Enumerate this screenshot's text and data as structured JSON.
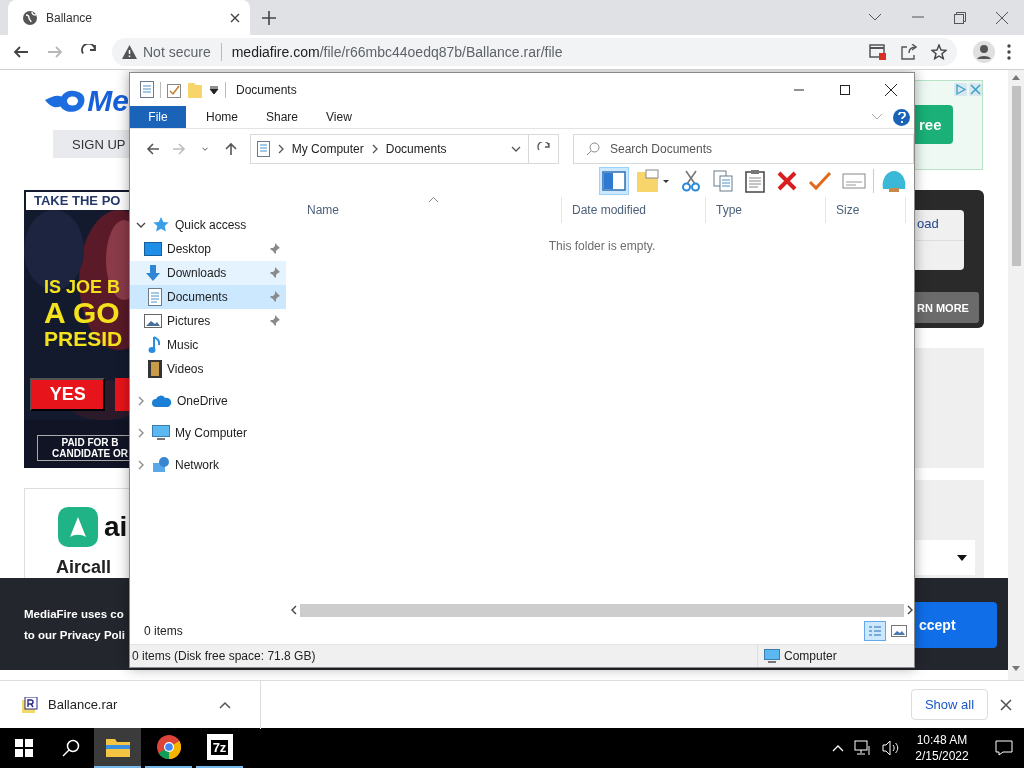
{
  "browser": {
    "tabs": [
      {
        "title": "Ballance",
        "selected": true
      }
    ],
    "nav_buttons": [
      {
        "kind": "back",
        "disabled": false
      },
      {
        "kind": "forward",
        "disabled": true
      },
      {
        "kind": "reload",
        "disabled": false
      }
    ],
    "address": {
      "security": "Not secure",
      "host": "mediafire.com",
      "path": "/file/r66mbc44oedq87b/Ballance.rar/file"
    }
  },
  "web_page": {
    "logo_text": "Me",
    "sign_up": "SIGN UP",
    "poll_ad": {
      "header": "TAKE THE PO",
      "lines": [
        "IS JOE B",
        "A GO",
        "PRESID"
      ],
      "answer": "YES",
      "disclaimer": [
        "PAID FOR B",
        "CANDIDATE OR"
      ]
    },
    "aircall_ad": {
      "logo_text": "ai",
      "title": "Aircall"
    },
    "side_ad": {
      "button": "ree"
    },
    "download_card": {
      "link": "oad",
      "button": "RN MORE"
    },
    "cookie_banner": {
      "lines": [
        "MediaFire uses co",
        "to our Privacy Poli"
      ],
      "button": "ccept"
    }
  },
  "explorer": {
    "title": "Documents",
    "ribbon_tabs": [
      {
        "label": "File",
        "kind": "file"
      },
      {
        "label": "Home",
        "kind": "tab"
      },
      {
        "label": "Share",
        "kind": "tab"
      },
      {
        "label": "View",
        "kind": "tab"
      }
    ],
    "nav_buttons": [
      {
        "kind": "back",
        "disabled": false
      },
      {
        "kind": "forward",
        "disabled": true
      },
      {
        "kind": "recent",
        "disabled": false
      },
      {
        "kind": "up",
        "disabled": false
      }
    ],
    "breadcrumb": [
      "My Computer",
      "Documents"
    ],
    "search": {
      "placeholder": "Search Documents"
    },
    "tools": [
      {
        "kind": "pane",
        "selected": true
      },
      {
        "kind": "folder",
        "selected": false
      },
      {
        "kind": "cut",
        "selected": false
      },
      {
        "kind": "copy",
        "selected": false
      },
      {
        "kind": "paste",
        "selected": false
      },
      {
        "kind": "delete",
        "selected": false
      },
      {
        "kind": "check",
        "selected": false
      },
      {
        "kind": "card",
        "selected": false
      },
      {
        "kind": "shell",
        "selected": false
      }
    ],
    "columns": [
      {
        "label": "Name",
        "sorted": true
      },
      {
        "label": "Date modified",
        "sorted": false
      },
      {
        "label": "Type",
        "sorted": false
      },
      {
        "label": "Size",
        "sorted": false
      }
    ],
    "empty_message": "This folder is empty.",
    "nav": [
      {
        "label": "Quick access",
        "kind": "star",
        "expanded": true,
        "selected": false,
        "children": [
          {
            "label": "Desktop",
            "kind": "desktop",
            "pinned": true,
            "selected": false,
            "hovered": false
          },
          {
            "label": "Downloads",
            "kind": "download",
            "pinned": true,
            "selected": false,
            "hovered": true
          },
          {
            "label": "Documents",
            "kind": "document",
            "pinned": true,
            "selected": true,
            "hovered": false
          },
          {
            "label": "Pictures",
            "kind": "picture",
            "pinned": true,
            "selected": false,
            "hovered": false
          },
          {
            "label": "Music",
            "kind": "music",
            "pinned": false,
            "selected": false,
            "hovered": false
          },
          {
            "label": "Videos",
            "kind": "video",
            "pinned": false,
            "selected": false,
            "hovered": false
          }
        ]
      },
      {
        "label": "OneDrive",
        "kind": "cloud",
        "expanded": false,
        "selected": false
      },
      {
        "label": "My Computer",
        "kind": "computer",
        "expanded": false,
        "selected": false
      },
      {
        "label": "Network",
        "kind": "network",
        "expanded": false,
        "selected": false
      }
    ],
    "item_count": "0 items",
    "views": [
      {
        "kind": "details",
        "selected": true
      },
      {
        "kind": "thumbnails",
        "selected": false
      }
    ],
    "status": {
      "text": "0 items (Disk free space: 71.8 GB)",
      "location": "Computer"
    }
  },
  "download_bar": {
    "file": "Ballance.rar",
    "show_all": "Show all"
  },
  "taskbar": {
    "apps": [
      {
        "kind": "explorer",
        "active": true
      },
      {
        "kind": "chrome",
        "active": false
      },
      {
        "kind": "sevenzip",
        "label": "7z",
        "active": false
      }
    ],
    "time": "10:48 AM",
    "date": "2/15/2022"
  }
}
